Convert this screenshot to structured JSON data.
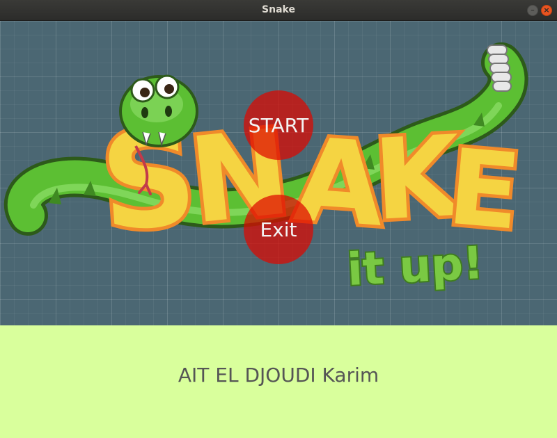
{
  "window": {
    "title": "Snake",
    "controls": {
      "minimize_glyph": "–",
      "close_glyph": "×"
    }
  },
  "game": {
    "background_color": "#4b6773",
    "logo": {
      "word": "SNAKE",
      "tagline": "it up!"
    },
    "menu": {
      "start_label": "START",
      "exit_label": "Exit",
      "button_color": "#de0800"
    }
  },
  "footer": {
    "author": "AIT EL DJOUDI Karim",
    "background_color": "#d9ff9c"
  },
  "colors": {
    "snake_green": "#5cbf33",
    "logo_yellow": "#f5d442",
    "logo_outline": "#f08a2a",
    "tagline_green": "#7ac943"
  }
}
